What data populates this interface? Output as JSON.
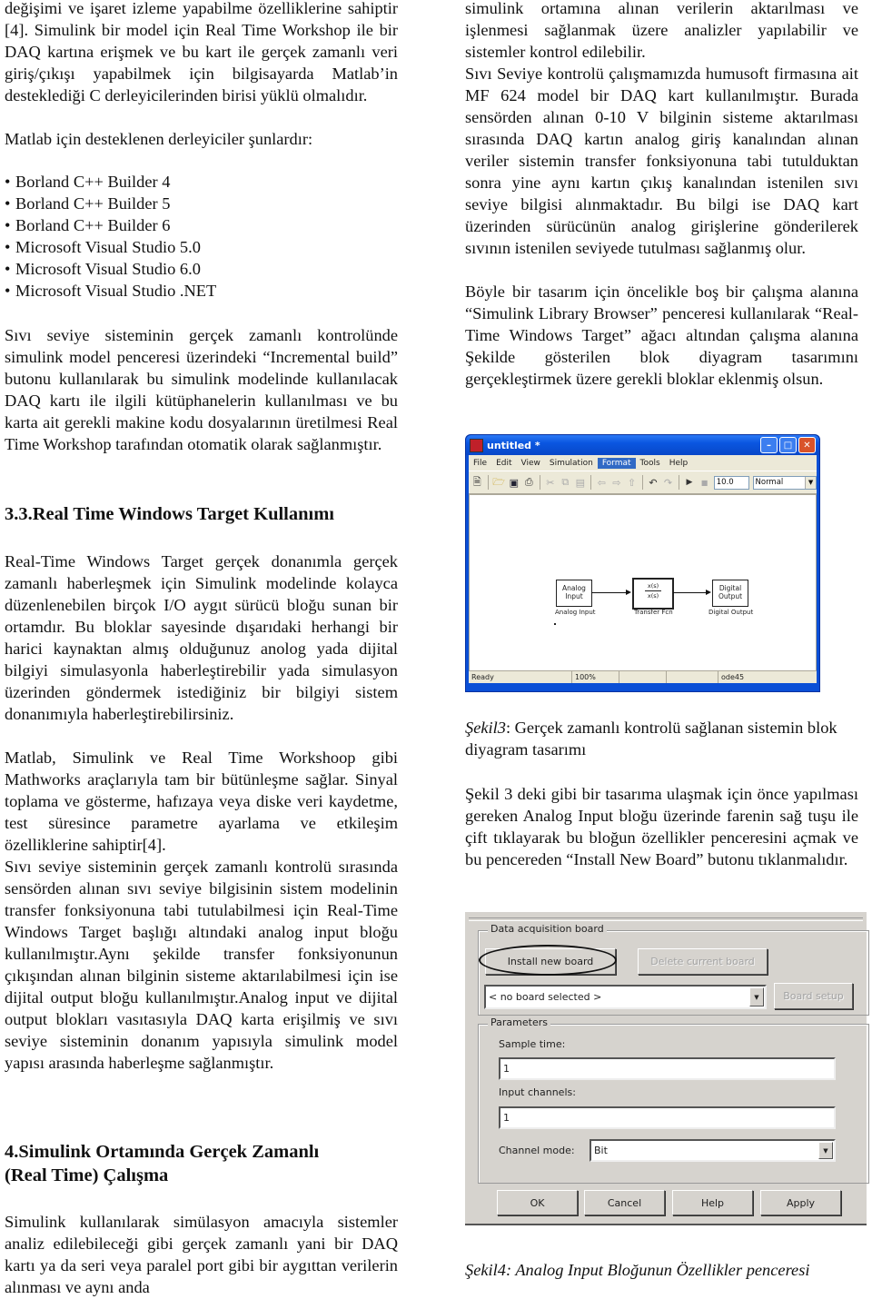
{
  "left_column": {
    "intro_paragraph": "değişimi ve işaret izleme yapabilme özelliklerine sahiptir [4]. Simulink bir model için Real Time Workshop ile bir DAQ kartına erişmek ve bu kart ile gerçek zamanlı veri giriş/çıkışı yapabilmek için bilgisayarda Matlab’in desteklediği C derleyicilerinden birisi yüklü olmalıdır.",
    "compilers_intro": "Matlab  için desteklenen derleyiciler şunlardır:",
    "compilers": [
      "Borland C++ Builder 4",
      "Borland C++ Builder 5",
      "Borland C++ Builder 6",
      "Microsoft Visual Studio 5.0",
      "Microsoft Visual Studio 6.0",
      "Microsoft Visual Studio .NET"
    ],
    "bullet_glyph": "•",
    "incremental_paragraph": "Sıvı seviye sisteminin gerçek zamanlı kontrolünde simulink model penceresi üzerindeki “Incremental build” butonu kullanılarak bu simulink modelinde kullanılacak DAQ kartı ile ilgili kütüphanelerin kullanılması ve bu karta ait gerekli makine kodu dosyalarının üretilmesi Real Time Workshop tarafından otomatik olarak sağlanmıştır.",
    "section_3_3_heading": "3.3.Real Time Windows Target Kullanımı",
    "rtwt_paragraph": " Real-Time Windows Target gerçek donanımla gerçek zamanlı haberleşmek için Simulink modelinde kolayca düzenlenebilen birçok I/O aygıt sürücü bloğu sunan bir ortamdır. Bu bloklar sayesinde dışarıdaki herhangi bir harici kaynaktan almış olduğunuz anolog yada dijital bilgiyi simulasyonla haberleştirebilir yada simulasyon üzerinden göndermek istediğiniz bir bilgiyi sistem donanımıyla haberleştirebilirsiniz.",
    "mathworks_paragraph": "Matlab, Simulink ve Real Time Workshoop gibi Mathworks araçlarıyla tam bir bütünleşme sağlar. Sinyal toplama ve gösterme, hafızaya veya diske veri kaydetme, test süresince parametre ayarlama ve etkileşim özelliklerine sahiptir[4].",
    "liquid_level_paragraph": "Sıvı seviye sisteminin gerçek zamanlı kontrolü sırasında sensörden alınan sıvı seviye bilgisinin sistem modelinin transfer fonksiyonuna tabi tutulabilmesi için Real-Time Windows Target başlığı altındaki analog input bloğu kullanılmıştır.Aynı şekilde transfer fonksiyonunun çıkışından alınan bilginin sisteme aktarılabilmesi için ise dijital output bloğu kullanılmıştır.Analog input ve dijital output blokları vasıtasıyla DAQ karta erişilmiş ve sıvı seviye sisteminin donanım yapısıyla simulink model yapısı arasında haberleşme sağlanmıştır.",
    "section_4_heading_line1": "4.Simulink Ortamında Gerçek Zamanlı",
    "section_4_heading_line2": "(Real Time) Çalışma",
    "section_4_paragraph": "Simulink kullanılarak simülasyon amacıyla sistemler analiz edilebileceği gibi gerçek zamanlı yani bir DAQ kartı ya da seri veya paralel port gibi bir aygıttan verilerin alınması ve aynı anda"
  },
  "right_column": {
    "continuation_paragraph": "simulink ortamına alınan verilerin aktarılması ve işlenmesi sağlanmak üzere  analizler yapılabilir ve sistemler kontrol edilebilir.",
    "daq_paragraph": "Sıvı Seviye kontrolü çalışmamızda humusoft firmasına ait MF 624 model bir DAQ kart kullanılmıştır. Burada sensörden alınan 0-10 V bilginin sisteme aktarılması sırasında DAQ kartın analog giriş kanalından alınan veriler sistemin transfer fonksiyonuna tabi tutulduktan sonra yine aynı kartın çıkış kanalından istenilen sıvı seviye bilgisi alınmaktadır. Bu bilgi ise DAQ kart üzerinden sürücünün analog girişlerine gönderilerek sıvının istenilen seviyede tutulması sağlanmış olur.",
    "design_paragraph": "Böyle bir tasarım için öncelikle boş bir çalışma alanına “Simulink Library Browser” penceresi kullanılarak “Real-Time Windows Target” ağacı altından çalışma alanına Şekilde gösterilen blok diyagram tasarımını gerçekleştirmek üzere gerekli bloklar eklenmiş olsun.",
    "figure3_caption_label": "Şekil3",
    "figure3_caption_text": ": Gerçek zamanlı kontrolü sağlanan sistemin blok diyagram tasarımı",
    "install_paragraph": "Şekil 3 deki gibi bir tasarıma ulaşmak için önce yapılması gereken Analog Input bloğu üzerinde farenin sağ tuşu ile çift tıklayarak bu bloğun özellikler penceresini açmak ve bu pencereden “Install New Board” butonu tıklanmalıdır.",
    "figure4_caption_label": "Şekil4",
    "figure4_caption_text": ": Analog Input Bloğunun Özellikler penceresi"
  },
  "simulink_window": {
    "title": "untitled *",
    "menu": [
      "File",
      "Edit",
      "View",
      "Simulation",
      "Format",
      "Tools",
      "Help"
    ],
    "active_menu_index": 4,
    "toolbar_icons": [
      "new-icon",
      "open-icon",
      "save-icon",
      "print-icon",
      "cut-icon",
      "copy-icon",
      "paste-icon",
      "back-icon",
      "forward-icon",
      "up-icon",
      "undo-icon",
      "redo-icon",
      "play-icon",
      "stop-icon"
    ],
    "stop_time": "10.0",
    "sim_mode": "Normal",
    "blocks": [
      {
        "inner": "Analog\nInput",
        "label": "Analog Input"
      },
      {
        "inner_num": "x(s)",
        "inner_den": "x(s)",
        "label": "Transfer Fcn"
      },
      {
        "inner": "Digital\nOutput",
        "label": "Digital Output"
      }
    ],
    "status": {
      "state": "Ready",
      "zoom": "100%",
      "solver": "ode45"
    }
  },
  "analog_input_dialog": {
    "daq_group_title": "Data acquisition board",
    "install_button": "Install new board",
    "delete_button": "Delete current board",
    "board_select_value": "< no board selected >",
    "board_setup_button": "Board setup",
    "params_group_title": "Parameters",
    "sample_time_label": "Sample time:",
    "sample_time_value": "1",
    "input_channels_label": "Input channels:",
    "input_channels_value": "1",
    "channel_mode_label": "Channel mode:",
    "channel_mode_value": "Bit",
    "buttons": {
      "ok": "OK",
      "cancel": "Cancel",
      "help": "Help",
      "apply": "Apply"
    }
  }
}
